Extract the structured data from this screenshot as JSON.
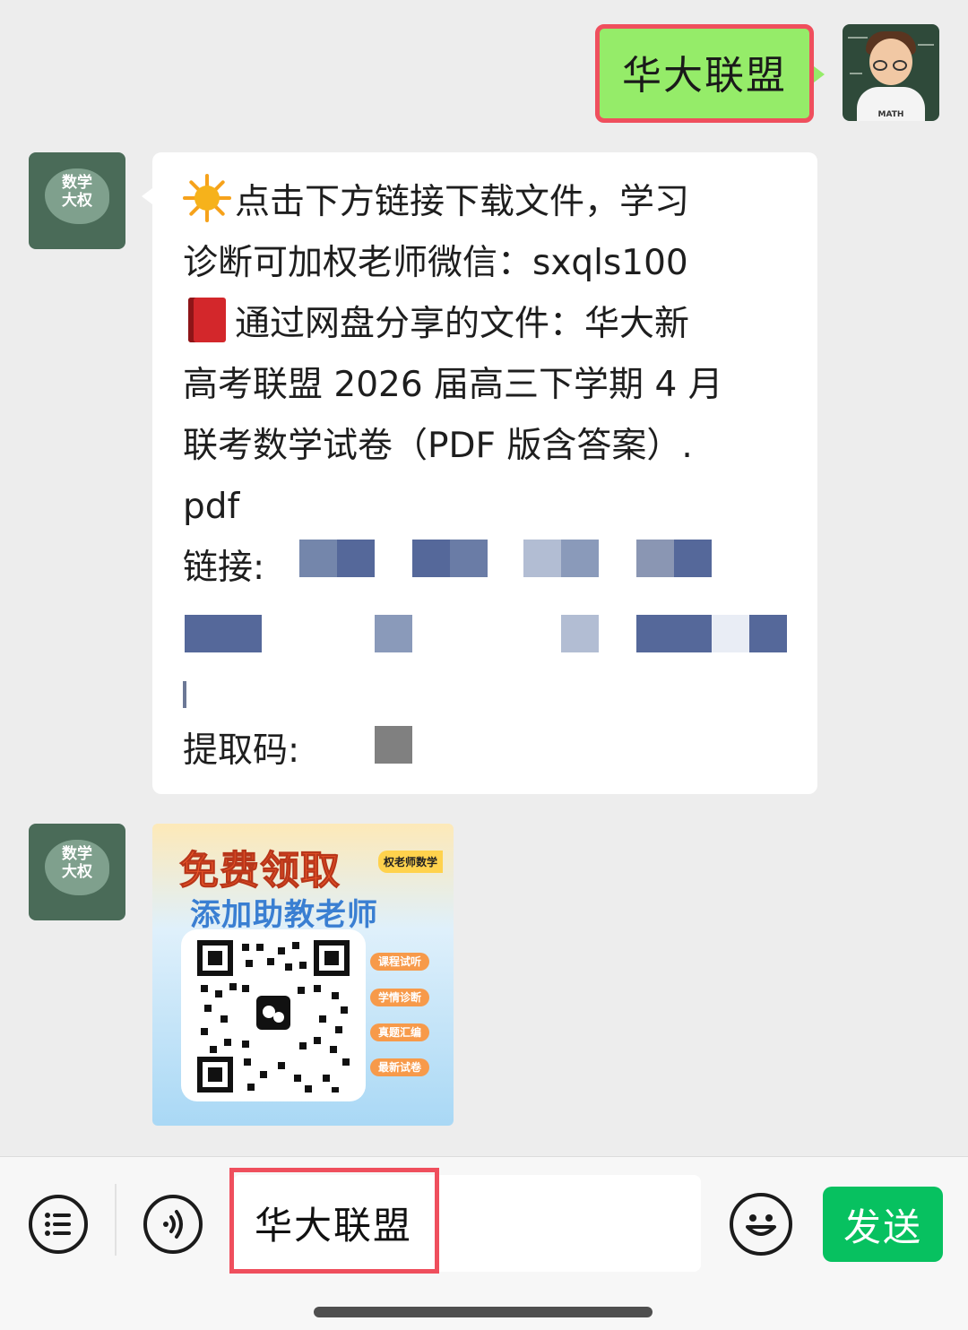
{
  "colors": {
    "chat_background": "#ededed",
    "sent_bubble": "#95ec69",
    "received_bubble": "#ffffff",
    "highlight_frame": "#ef4f5d",
    "send_button": "#07c160",
    "redaction": "#5a6f9e"
  },
  "sent_message": {
    "text": "华大联盟"
  },
  "bot_avatar": {
    "label": "数学\n大权"
  },
  "user_avatar": {
    "shirt_text": "MATH"
  },
  "text_message": {
    "lines": [
      "点击下方链接下载文件，学习",
      "诊断可加权老师微信：sxqls100",
      "通过网盘分享的文件：华大新",
      "高考联盟 2026 届高三下学期 4 月",
      "联考数学试卷（PDF 版含答案）.",
      "pdf"
    ],
    "link_label": "链接:",
    "code_label": "提取码:",
    "icons": [
      "sun-emoji",
      "red-book-emoji"
    ]
  },
  "image_card": {
    "title": "免费领取",
    "subtitle": "添加助教老师",
    "badge": "权老师数学",
    "tags": [
      "课程试听",
      "学情诊断",
      "真题汇编",
      "最新试卷"
    ]
  },
  "input_bar": {
    "text_value": "华大联盟",
    "send_label": "发送",
    "icons": [
      "menu-icon",
      "voice-icon",
      "emoji-icon"
    ]
  }
}
